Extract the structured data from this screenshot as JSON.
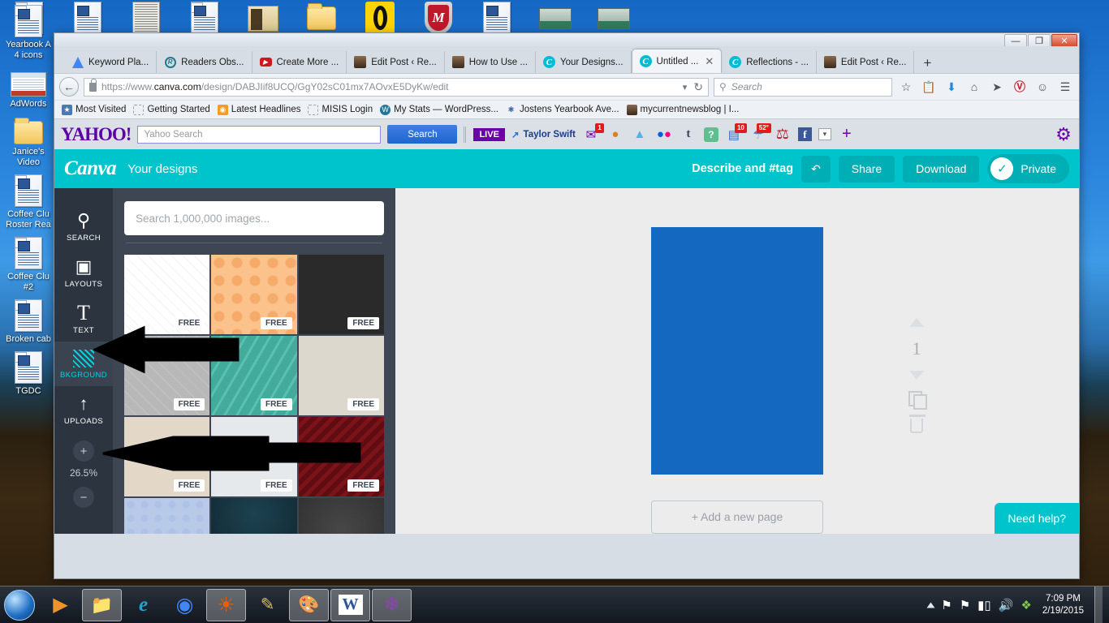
{
  "desktop": {
    "top_row_icons": [
      {
        "name": "word-doc-stack-icon",
        "type": "doc-stack"
      },
      {
        "name": "word-doc-icon",
        "type": "doc"
      },
      {
        "name": "newspaper-icon",
        "type": "news"
      },
      {
        "name": "word-doc-stack-icon-2",
        "type": "doc-stack"
      },
      {
        "name": "open-folder-icon",
        "type": "openfolder"
      },
      {
        "name": "folder-icon",
        "type": "folder"
      },
      {
        "name": "oval-logo-icon",
        "type": "oval"
      },
      {
        "name": "mcafee-shield-icon",
        "type": "mcafee"
      },
      {
        "name": "word-doc-icon-2",
        "type": "doc"
      },
      {
        "name": "photo-thumb-icon",
        "type": "photo"
      },
      {
        "name": "photo-thumb-icon-2",
        "type": "photo"
      }
    ],
    "left_icons": [
      {
        "label": "Yearbook A\n4 icons",
        "type": "doc-stack"
      },
      {
        "label": "AdWords",
        "type": "adwords"
      },
      {
        "label": "Janice's\nVideo",
        "type": "folder"
      },
      {
        "label": "Coffee Clu\nRoster Rea",
        "type": "doc-stack"
      },
      {
        "label": "Coffee Clu\n#2",
        "type": "doc-stack"
      },
      {
        "label": "Broken cab",
        "type": "doc-stack"
      },
      {
        "label": "TGDC",
        "type": "doc-stack"
      }
    ]
  },
  "browser": {
    "window_controls": {
      "minimize": "—",
      "maximize": "❐",
      "close": "✕"
    },
    "tabs": [
      {
        "title": "Keyword Pla...",
        "favicon": "google-ads-icon",
        "active": false,
        "closable": false
      },
      {
        "title": "Readers Obs...",
        "favicon": "readers-icon",
        "active": false,
        "closable": false
      },
      {
        "title": "Create More ...",
        "favicon": "youtube-icon",
        "active": false,
        "closable": false
      },
      {
        "title": "Edit Post ‹ Re...",
        "favicon": "avatar-icon",
        "active": false,
        "closable": false
      },
      {
        "title": "How to Use ...",
        "favicon": "avatar-icon",
        "active": false,
        "closable": false
      },
      {
        "title": "Your Designs...",
        "favicon": "canva-icon",
        "active": false,
        "closable": false
      },
      {
        "title": "Untitled ...",
        "favicon": "canva-icon",
        "active": true,
        "closable": true
      },
      {
        "title": "Reflections - ...",
        "favicon": "canva-icon",
        "active": false,
        "closable": false
      },
      {
        "title": "Edit Post ‹ Re...",
        "favicon": "avatar-icon",
        "active": false,
        "closable": false
      }
    ],
    "new_tab_label": "+",
    "url": {
      "scheme": "https://www.",
      "domain": "canva.com",
      "path": "/design/DABJIif8UCQ/GgY02sC01mx7AOvxE5DyKw/edit",
      "full": "https://www.canva.com/design/DABJIif8UCQ/GgY02sC01mx7AOvxE5DyKw/edit"
    },
    "search_placeholder": "Search",
    "nav_icons": [
      "bookmark-star-icon",
      "reading-list-icon",
      "downloads-icon",
      "home-icon",
      "send-tab-icon",
      "pinterest-icon",
      "chat-icon",
      "hamburger-menu-icon"
    ],
    "bookmarks": [
      {
        "label": "Most Visited",
        "icon": "most-visited-icon"
      },
      {
        "label": "Getting Started",
        "icon": "dashed-icon"
      },
      {
        "label": "Latest Headlines",
        "icon": "rss-icon"
      },
      {
        "label": "MISIS Login",
        "icon": "dashed-icon"
      },
      {
        "label": "My Stats — WordPress...",
        "icon": "wordpress-icon"
      },
      {
        "label": "Jostens Yearbook Ave...",
        "icon": "jostens-icon"
      },
      {
        "label": "mycurrentnewsblog | I...",
        "icon": "avatar-icon"
      }
    ]
  },
  "yahoo_toolbar": {
    "logo": "YAHOO!",
    "search_placeholder": "Yahoo Search",
    "search_button": "Search",
    "live_badge": "LIVE",
    "trending_label": "Taylor Swift",
    "icons": [
      {
        "name": "mail-icon",
        "glyph": "✉",
        "badge": "1",
        "color": "#6b00a8"
      },
      {
        "name": "basketball-icon",
        "glyph": "●",
        "badge": "",
        "color": "#e08020"
      },
      {
        "name": "finance-icon",
        "glyph": "↗",
        "badge": "",
        "color": "#4fb3e8"
      },
      {
        "name": "flickr-icon",
        "glyph": "●●",
        "badge": "",
        "color": "#ff0084"
      },
      {
        "name": "tumblr-icon",
        "glyph": "t",
        "badge": "",
        "color": "#35465c"
      },
      {
        "name": "answers-icon",
        "glyph": "?",
        "badge": "",
        "color": "#5fbf8f"
      },
      {
        "name": "news-icon",
        "glyph": "▤",
        "badge": "10",
        "color": "#3b6fb5"
      },
      {
        "name": "weather-icon",
        "glyph": "☂",
        "badge": "52°",
        "color": "#5a80b0"
      },
      {
        "name": "bookmarks-icon",
        "glyph": "⚑",
        "badge": "",
        "color": "#c0182b"
      },
      {
        "name": "facebook-icon",
        "glyph": "f",
        "badge": "",
        "color": "#3b5998"
      },
      {
        "name": "dropdown-icon",
        "glyph": "▾",
        "badge": "",
        "color": "#6d747c"
      },
      {
        "name": "add-icon",
        "glyph": "+",
        "badge": "",
        "color": "#6b00a8"
      },
      {
        "name": "settings-gear-icon",
        "glyph": "⚙",
        "badge": "",
        "color": "#6b00a8"
      }
    ]
  },
  "canva": {
    "logo": "Canva",
    "subtitle": "Your designs",
    "describe_label": "Describe and #tag",
    "undo_label": "↶",
    "share_label": "Share",
    "download_label": "Download",
    "privacy_label": "Private",
    "rail": [
      {
        "label": "SEARCH",
        "icon": "magnifier-icon",
        "glyph": "⌕",
        "active": false
      },
      {
        "label": "LAYOUTS",
        "icon": "layouts-icon",
        "glyph": "◱",
        "active": false
      },
      {
        "label": "TEXT",
        "icon": "text-icon",
        "glyph": "T",
        "active": false
      },
      {
        "label": "BKGROUND",
        "icon": "background-hatch-icon",
        "glyph": "",
        "active": true
      },
      {
        "label": "UPLOADS",
        "icon": "upload-arrow-icon",
        "glyph": "↑",
        "active": false
      }
    ],
    "zoom_in_label": "+",
    "zoom_value": "26.5%",
    "zoom_out_label": "−",
    "panel_search_placeholder": "Search 1,000,000 images...",
    "free_tag": "FREE",
    "backgrounds": [
      {
        "name": "white-diamond-pattern",
        "css": "repeating-linear-gradient(45deg,#ffffff 0 9px,#f2f2f2 9px 10px),repeating-linear-gradient(-45deg,#ffffff 0 9px,#f2f2f2 9px 10px)",
        "base": "#ffffff"
      },
      {
        "name": "orange-polkadot",
        "css": "radial-gradient(circle at 10px 10px,#f7ab6a 6px,transparent 7px)",
        "base": "#fbc28c",
        "size": "22px 22px"
      },
      {
        "name": "dark-charcoal-texture",
        "css": "none",
        "base": "#2a2a2a"
      },
      {
        "name": "gray-plaid",
        "css": "repeating-linear-gradient(45deg,#b8b8b8 0 10px,#c4c4c4 10px 11px),repeating-linear-gradient(-45deg,rgba(200,200,200,.6) 0 10px,rgba(230,230,230,.7) 10px 11px)",
        "base": "#bdbdbd"
      },
      {
        "name": "teal-diagonal-stripes",
        "css": "repeating-linear-gradient(120deg,#43ab9c 0 10px,#5cc0b1 10px 13px)",
        "base": "#43ab9c"
      },
      {
        "name": "cream-concrete",
        "css": "none",
        "base": "#ddd8cd"
      },
      {
        "name": "beige-linen",
        "css": "none",
        "base": "#e3d8c8"
      },
      {
        "name": "white-marble",
        "css": "none",
        "base": "#e6e9ec"
      },
      {
        "name": "dark-red-chevron",
        "css": "repeating-linear-gradient(135deg,#5e0d12 0 6px,#7d1319 6px 11px)",
        "base": "#5e0d12"
      },
      {
        "name": "blue-dot-pattern",
        "css": "radial-gradient(circle at 8px 8px,#aec2e8 4px,transparent 5px)",
        "base": "#b9cae9",
        "size": "17px 17px"
      },
      {
        "name": "dark-teal-gradient",
        "css": "radial-gradient(circle at 50% 20%,#1d4250,#0d2029)",
        "base": "#143441"
      },
      {
        "name": "dark-gray-gradient",
        "css": "radial-gradient(circle at 50% 40%,#474747,#2e2e2e)",
        "base": "#3a3a3a"
      }
    ],
    "page_number": "1",
    "add_page_label": "+ Add a new page",
    "need_help_label": "Need help?",
    "page_tools": [
      "move-up-icon",
      "duplicate-page-icon",
      "delete-page-icon"
    ]
  },
  "taskbar": {
    "start_label": "Start",
    "items": [
      {
        "name": "media-player-icon",
        "running": false
      },
      {
        "name": "file-explorer-icon",
        "running": true
      },
      {
        "name": "internet-explorer-icon",
        "running": false
      },
      {
        "name": "chrome-icon",
        "running": false
      },
      {
        "name": "firefox-icon",
        "running": true
      },
      {
        "name": "onenote-icon",
        "running": false
      },
      {
        "name": "paint-icon",
        "running": true
      },
      {
        "name": "word-icon",
        "running": true
      },
      {
        "name": "picasa-icon",
        "running": true
      }
    ],
    "tray_icons": [
      "show-hidden-icon",
      "network-error-icon",
      "action-center-icon",
      "signal-icon",
      "volume-icon",
      "dropbox-icon"
    ],
    "time": "7:09 PM",
    "date": "2/19/2015"
  }
}
